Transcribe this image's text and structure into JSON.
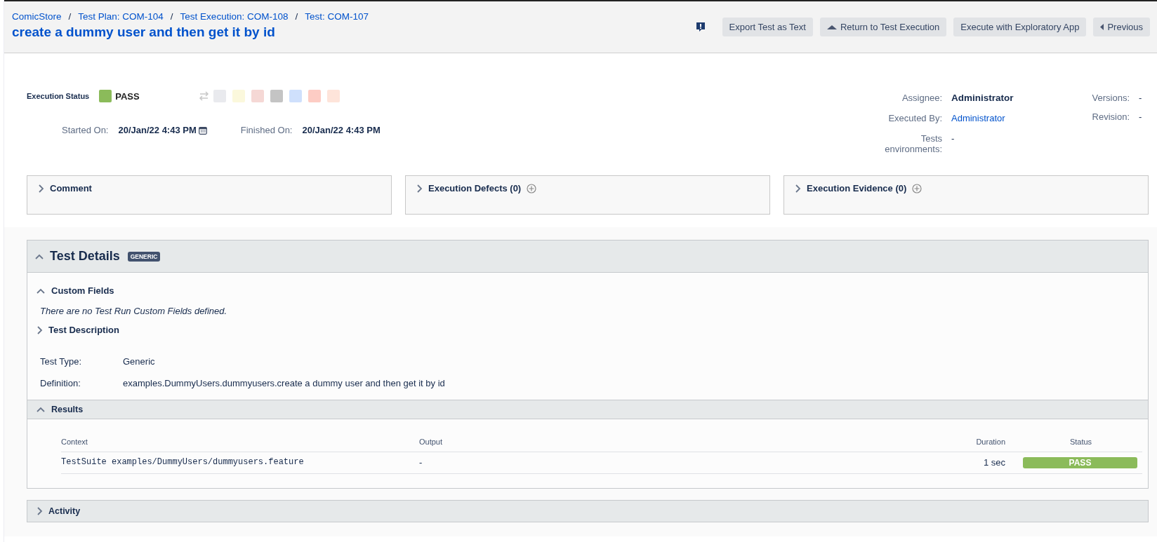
{
  "breadcrumbs": [
    {
      "text": "ComicStore",
      "kind": "link"
    },
    {
      "text": "/",
      "kind": "separator"
    },
    {
      "text": "Test Plan: COM-104",
      "kind": "link"
    },
    {
      "text": "/",
      "kind": "separator"
    },
    {
      "text": "Test Execution: COM-108",
      "kind": "link"
    },
    {
      "text": "/",
      "kind": "separator"
    },
    {
      "text": "Test: COM-107",
      "kind": "link"
    }
  ],
  "title": "create a dummy user and then get it by id",
  "toolbar": {
    "buttons": [
      {
        "label": "Export Test as Text",
        "kind": "plain"
      },
      {
        "label": "Return to Test Execution",
        "kind": "up"
      },
      {
        "label": "Execute with Exploratory App",
        "kind": "plain"
      },
      {
        "label": "Previous",
        "kind": "back"
      }
    ]
  },
  "execution": {
    "label": "Execution Status",
    "status": "PASS",
    "kind": "pass",
    "status_options": [
      {
        "color": "#e9eaee"
      },
      {
        "color": "#fbf8dc"
      },
      {
        "color": "#f5d8d5"
      },
      {
        "color": "#c4c4c4"
      },
      {
        "color": "#cfe0fc"
      },
      {
        "color": "#fdccc4"
      },
      {
        "color": "#fee4da"
      }
    ],
    "started_label": "Started On:",
    "started": "20/Jan/22 4:43 PM",
    "finished_label": "Finished On:",
    "finished": "20/Jan/22 4:43 PM"
  },
  "people": [
    {
      "label": "Assignee:",
      "value": "Administrator",
      "kind": "bold"
    },
    {
      "label": "Executed By:",
      "value": "Administrator",
      "kind": "link"
    },
    {
      "label": "Tests environments:",
      "value": "-",
      "kind": "plain"
    }
  ],
  "meta": [
    {
      "label": "Versions:",
      "value": "-"
    },
    {
      "label": "Revision:",
      "value": "-"
    }
  ],
  "panels": [
    {
      "title": "Comment",
      "expanded": false,
      "add": false
    },
    {
      "title": "Execution Defects (0)",
      "expanded": false,
      "add": true
    },
    {
      "title": "Execution Evidence (0)",
      "expanded": false,
      "add": true
    }
  ],
  "test_details": {
    "title": "Test Details",
    "badge": "GENERIC",
    "expanded": true,
    "custom_fields": {
      "title": "Custom Fields",
      "expanded": true,
      "note": "There are no Test Run Custom Fields defined."
    },
    "description": {
      "title": "Test Description",
      "expanded": false
    },
    "fields": [
      {
        "label": "Test Type:",
        "value": "Generic"
      },
      {
        "label": "Definition:",
        "value": "examples.DummyUsers.dummyusers.create a dummy user and then get it by id"
      }
    ],
    "results": {
      "title": "Results",
      "expanded": true,
      "columns": [
        "Context",
        "Output",
        "Duration",
        "Status"
      ],
      "rows": [
        {
          "context": "TestSuite examples/DummyUsers/dummyusers.feature",
          "output": "-",
          "duration": "1 sec",
          "status": "PASS",
          "color": "#8bbb5a"
        }
      ]
    }
  },
  "activity": {
    "title": "Activity",
    "expanded": false
  }
}
